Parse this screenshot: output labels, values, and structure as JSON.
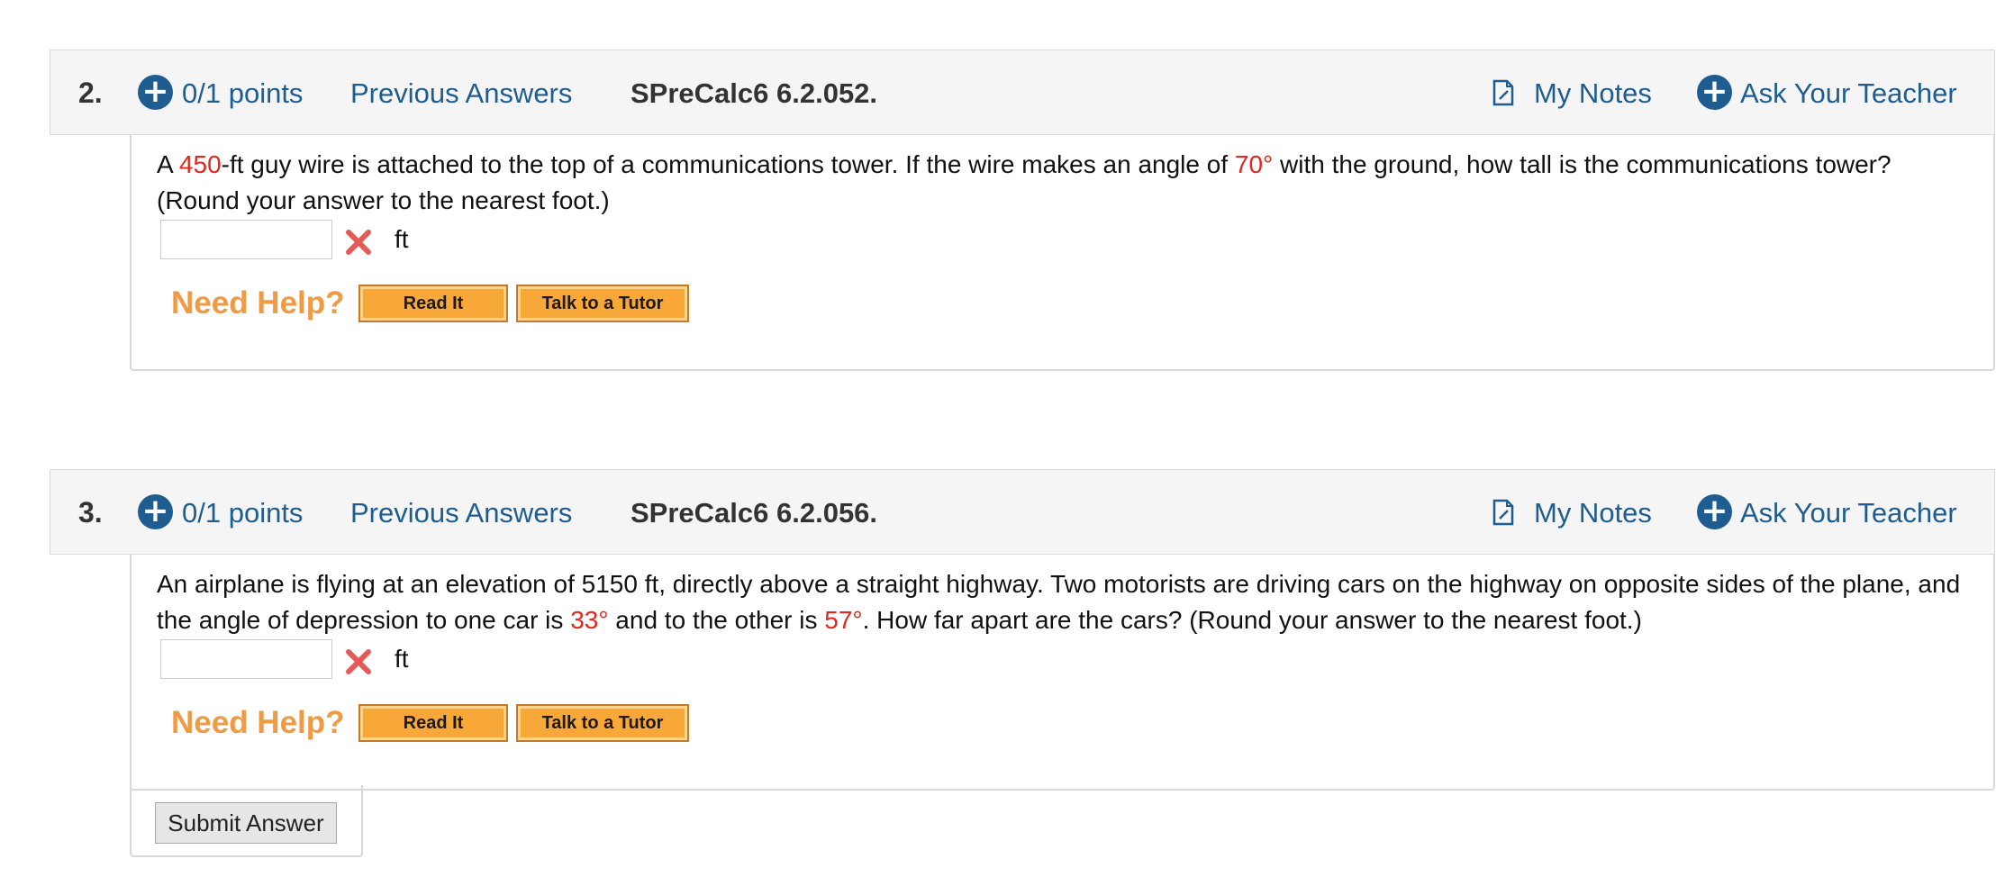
{
  "questions": [
    {
      "number": "2.",
      "points": "0/1 points",
      "previous_answers": "Previous Answers",
      "code": "SPreCalc6 6.2.052.",
      "my_notes": "My Notes",
      "ask_teacher": "Ask Your Teacher",
      "text_parts": [
        "A ",
        "450",
        "-ft guy wire is attached to the top of a communications tower. If the wire makes an angle of ",
        "70°",
        " with the ground, how tall is the communications tower? (Round your answer to the nearest foot.)"
      ],
      "answer_value": "",
      "unit": "ft",
      "need_help": "Need Help?",
      "read_it": "Read It",
      "talk_tutor": "Talk to a Tutor"
    },
    {
      "number": "3.",
      "points": "0/1 points",
      "previous_answers": "Previous Answers",
      "code": "SPreCalc6 6.2.056.",
      "my_notes": "My Notes",
      "ask_teacher": "Ask Your Teacher",
      "text_parts": [
        "An airplane is flying at an elevation of 5150 ft, directly above a straight highway. Two motorists are driving cars on the highway on opposite sides of the plane, and the angle of depression to one car is ",
        "33°",
        " and to the other is ",
        "57°",
        ". How far apart are the cars? (Round your answer to the nearest foot.)"
      ],
      "answer_value": "",
      "unit": "ft",
      "need_help": "Need Help?",
      "read_it": "Read It",
      "talk_tutor": "Talk to a Tutor"
    }
  ],
  "submit_label": "Submit Answer",
  "colors": {
    "link": "#1f5d91",
    "highlight": "#e0281e",
    "help": "#ef9a45",
    "button": "#f7a838"
  },
  "icons": {
    "plus": "plus-circle-icon",
    "notes": "note-icon",
    "incorrect": "incorrect-x-icon"
  }
}
